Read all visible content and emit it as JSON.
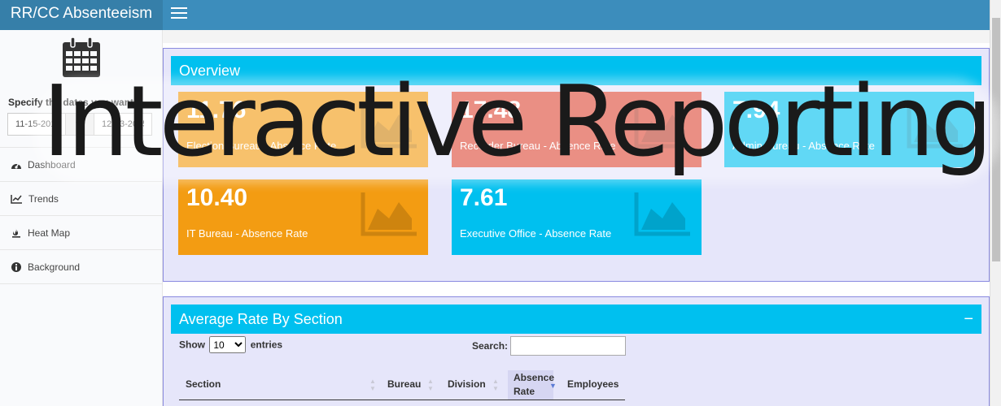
{
  "app": {
    "title": "RR/CC Absenteeism"
  },
  "sidebar": {
    "date_label": "Specify the dates you want",
    "date_from": "11-15-2014",
    "date_sep": "to",
    "date_to": "12-13-2015",
    "menu": [
      {
        "label": "Dashboard",
        "icon": "dashboard-icon"
      },
      {
        "label": "Trends",
        "icon": "line-chart-icon"
      },
      {
        "label": "Heat Map",
        "icon": "fire-icon"
      },
      {
        "label": "Background",
        "icon": "info-circle-icon"
      }
    ]
  },
  "overview": {
    "title": "Overview",
    "cards": [
      {
        "value": "11.76",
        "label": "Election Bureau - Absence Rate",
        "color": "#f39c12"
      },
      {
        "value": "17.48",
        "label": "Recorder Bureau - Absence Rate",
        "color": "#dd4b39"
      },
      {
        "value": "7.94",
        "label": "Admin Bureau - Absence Rate",
        "color": "#00c0ef"
      },
      {
        "value": "10.40",
        "label": "IT Bureau - Absence Rate",
        "color": "#f39c12"
      },
      {
        "value": "7.61",
        "label": "Executive Office - Absence Rate",
        "color": "#00c0ef"
      }
    ]
  },
  "avg_rate": {
    "title": "Average Rate By Section",
    "collapse": "−",
    "show_label": "Show",
    "entries_value": "10",
    "entries_label": "entries",
    "search_label": "Search:",
    "columns": [
      "Section",
      "Bureau",
      "Division",
      "Absence Rate",
      "Employees"
    ]
  },
  "watermark": {
    "text": "Interactive Reporting"
  }
}
